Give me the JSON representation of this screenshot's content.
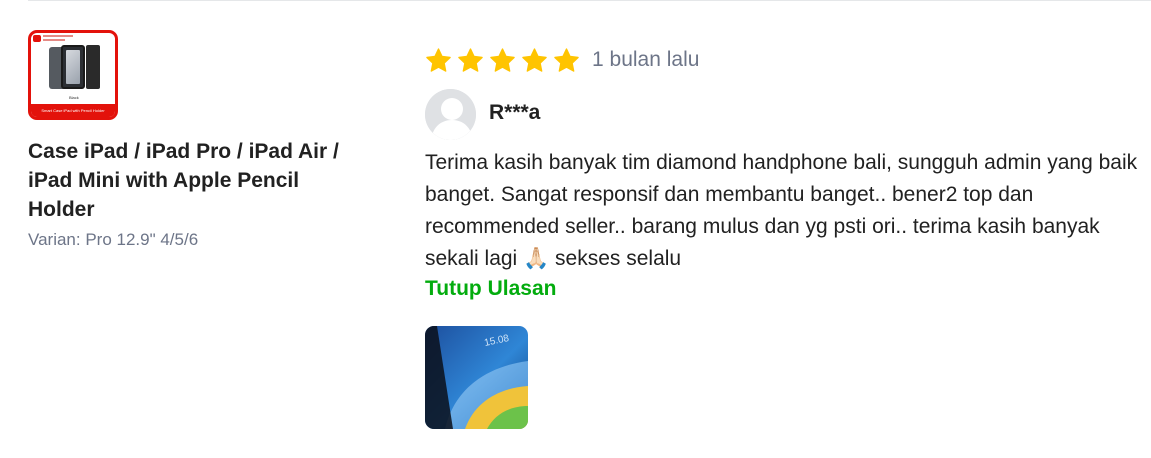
{
  "product": {
    "thumbnail_caption": "Black",
    "thumbnail_banner": "Smart Case iPad with Pencil Holder",
    "name": "Case iPad / iPad Pro / iPad Air / iPad Mini with Apple Pencil Holder",
    "variant": "Varian: Pro 12.9\" 4/5/6"
  },
  "review": {
    "rating": 5,
    "rating_max": 5,
    "star_color": "#ffc400",
    "time": "1 bulan lalu",
    "reviewer": "R***a",
    "text": "Terima kasih banyak tim diamond handphone bali, sungguh admin yang baik banget. Sangat responsif dan membantu banget.. bener2 top dan recommended seller.. barang mulus dan yg psti ori.. terima kasih banyak sekali lagi 🙏🏻 sekses selalu",
    "toggle_label": "Tutup Ulasan",
    "photo": {
      "clock": "15.08"
    }
  },
  "colors": {
    "accent_green": "#03ac0e",
    "brand_red": "#e3120b",
    "muted_text": "#6d7588"
  }
}
